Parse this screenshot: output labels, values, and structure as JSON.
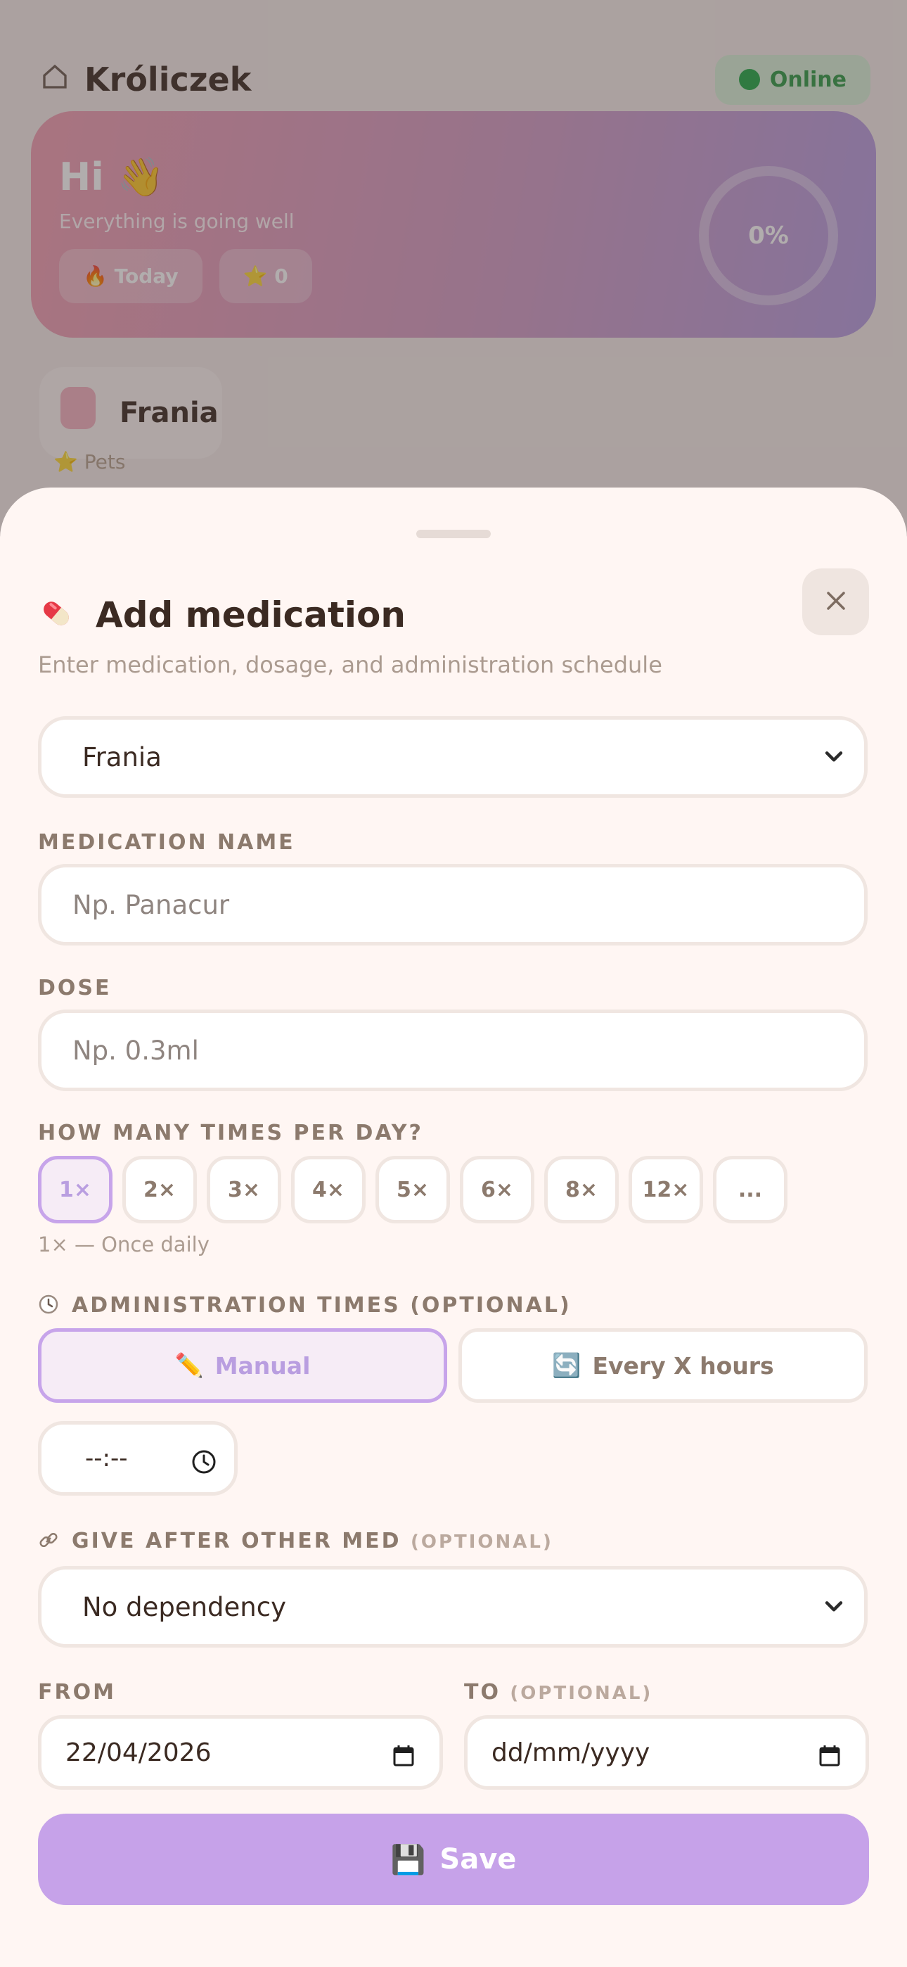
{
  "background": {
    "app_title": "Króliczek",
    "status_badge": "Online",
    "hero": {
      "greeting": "Hi",
      "subtitle": "Everything is going well",
      "chip_1": "Today",
      "chip_2": "0",
      "ring_value": "0%"
    },
    "pet": {
      "name": "Frania",
      "meta": "Pets"
    }
  },
  "sheet": {
    "title": "Add medication",
    "subtitle": "Enter medication, dosage, and administration schedule",
    "pet_select": {
      "value": "Frania"
    },
    "medication_name": {
      "label": "MEDICATION NAME",
      "placeholder": "Np. Panacur"
    },
    "dose": {
      "label": "DOSE",
      "placeholder": "Np. 0.3ml"
    },
    "frequency": {
      "label": "HOW MANY TIMES PER DAY?",
      "options": [
        "1×",
        "2×",
        "3×",
        "4×",
        "5×",
        "6×",
        "8×",
        "12×",
        "..."
      ],
      "selected_index": 0,
      "hint": "1× — Once daily"
    },
    "admin_times": {
      "label": "ADMINISTRATION TIMES",
      "optional": "(OPTIONAL)",
      "icon": "clock-icon",
      "modes": [
        {
          "icon": "✏️",
          "label": "Manual"
        },
        {
          "icon": "🔄",
          "label": "Every X hours"
        }
      ],
      "selected_mode": 0,
      "time_value": "--:--"
    },
    "dependency": {
      "label": "GIVE AFTER OTHER MED",
      "optional": "(OPTIONAL)",
      "icon": "link-icon",
      "value": "No dependency"
    },
    "from": {
      "label": "FROM",
      "value": "22/04/2026"
    },
    "to": {
      "label": "TO",
      "optional": "(OPTIONAL)",
      "placeholder": "dd/mm/yyyy"
    },
    "save_button": {
      "icon": "💾",
      "label": "Save"
    }
  },
  "colors": {
    "accent": "#c6a2e9",
    "sheet_bg": "#fff6f3",
    "text_dark": "#3b2a22",
    "label": "#8c7a6d"
  }
}
